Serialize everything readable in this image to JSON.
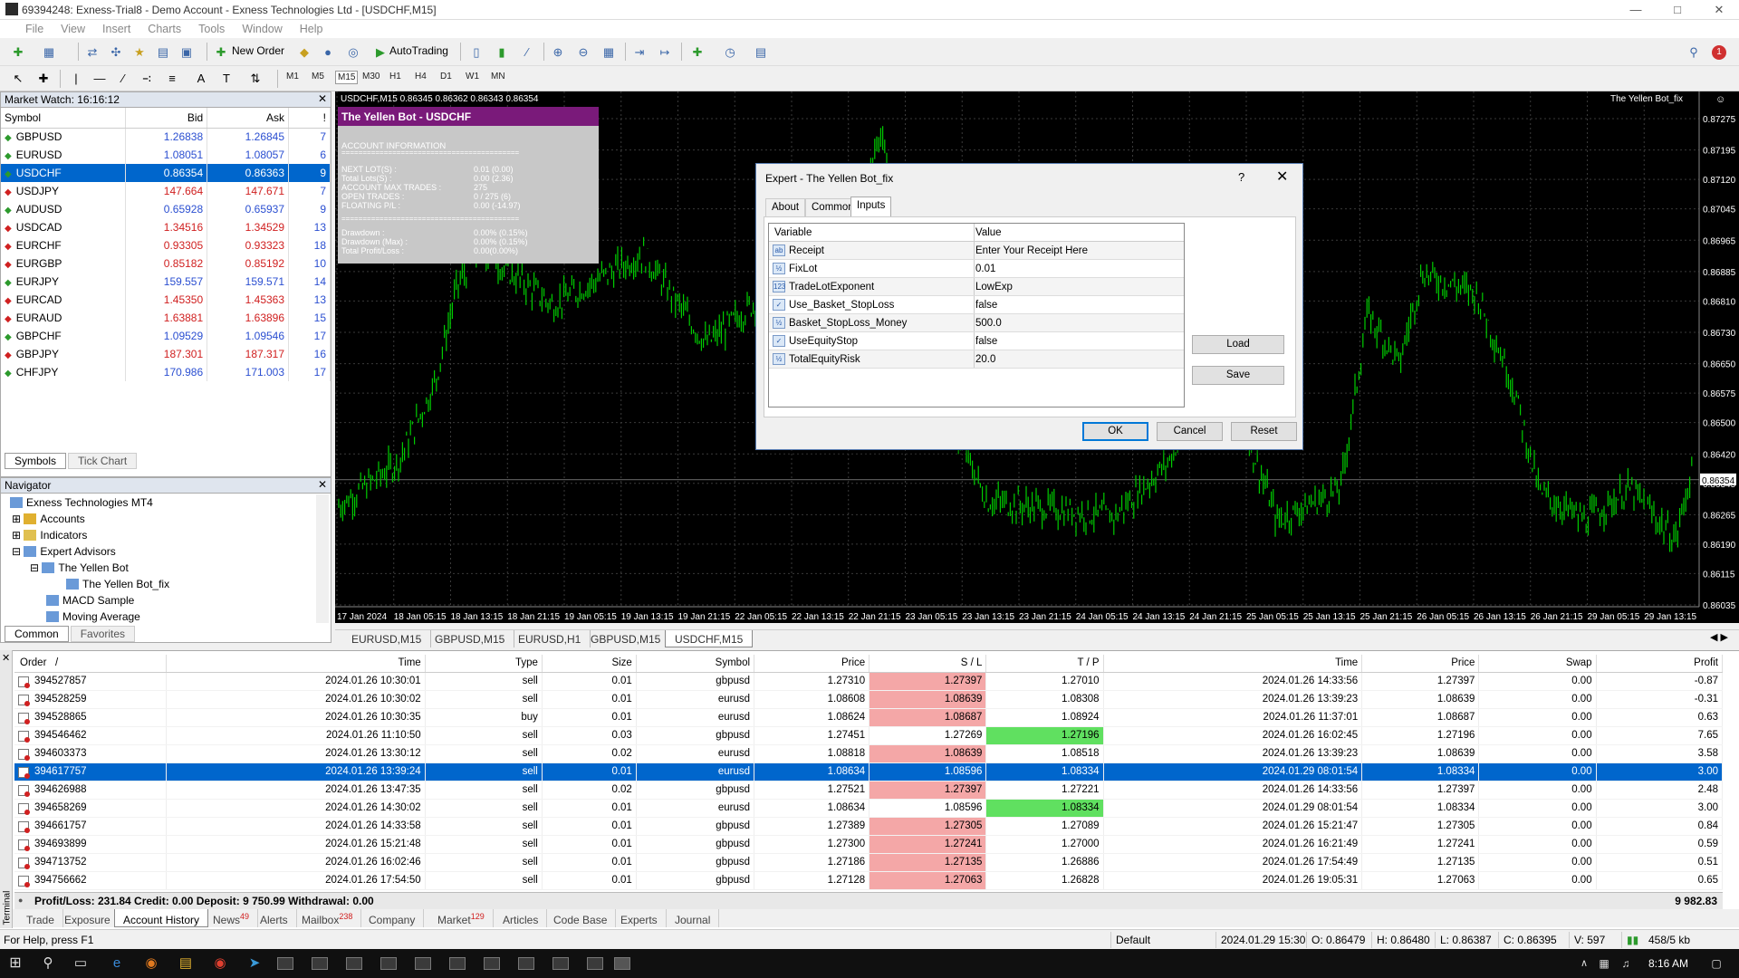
{
  "window": {
    "title": "69394248: Exness-Trial8 - Demo Account - Exness Technologies Ltd - [USDCHF,M15]"
  },
  "menu": [
    "File",
    "View",
    "Insert",
    "Charts",
    "Tools",
    "Window",
    "Help"
  ],
  "toolbar": {
    "new_order": "New Order",
    "autotrading": "AutoTrading",
    "timeframes": [
      "M1",
      "M5",
      "M15",
      "M30",
      "H1",
      "H4",
      "D1",
      "W1",
      "MN"
    ],
    "alert_count": "1"
  },
  "market_watch": {
    "title": "Market Watch: 16:16:12",
    "headers": {
      "symbol": "Symbol",
      "bid": "Bid",
      "ask": "Ask",
      "spread": "!"
    },
    "rows": [
      {
        "symbol": "GBPUSD",
        "bid": "1.26838",
        "ask": "1.26845",
        "spread": "7",
        "dir": "up"
      },
      {
        "symbol": "EURUSD",
        "bid": "1.08051",
        "ask": "1.08057",
        "spread": "6",
        "dir": "up"
      },
      {
        "symbol": "USDCHF",
        "bid": "0.86354",
        "ask": "0.86363",
        "spread": "9",
        "dir": "up"
      },
      {
        "symbol": "USDJPY",
        "bid": "147.664",
        "ask": "147.671",
        "spread": "7",
        "dir": "down"
      },
      {
        "symbol": "AUDUSD",
        "bid": "0.65928",
        "ask": "0.65937",
        "spread": "9",
        "dir": "up"
      },
      {
        "symbol": "USDCAD",
        "bid": "1.34516",
        "ask": "1.34529",
        "spread": "13",
        "dir": "down"
      },
      {
        "symbol": "EURCHF",
        "bid": "0.93305",
        "ask": "0.93323",
        "spread": "18",
        "dir": "down"
      },
      {
        "symbol": "EURGBP",
        "bid": "0.85182",
        "ask": "0.85192",
        "spread": "10",
        "dir": "down"
      },
      {
        "symbol": "EURJPY",
        "bid": "159.557",
        "ask": "159.571",
        "spread": "14",
        "dir": "up"
      },
      {
        "symbol": "EURCAD",
        "bid": "1.45350",
        "ask": "1.45363",
        "spread": "13",
        "dir": "down"
      },
      {
        "symbol": "EURAUD",
        "bid": "1.63881",
        "ask": "1.63896",
        "spread": "15",
        "dir": "down"
      },
      {
        "symbol": "GBPCHF",
        "bid": "1.09529",
        "ask": "1.09546",
        "spread": "17",
        "dir": "up"
      },
      {
        "symbol": "GBPJPY",
        "bid": "187.301",
        "ask": "187.317",
        "spread": "16",
        "dir": "down"
      },
      {
        "symbol": "CHFJPY",
        "bid": "170.986",
        "ask": "171.003",
        "spread": "17",
        "dir": "up"
      }
    ],
    "tabs": [
      "Symbols",
      "Tick Chart"
    ]
  },
  "navigator": {
    "title": "Navigator",
    "items": [
      "Exness Technologies MT4",
      "Accounts",
      "Indicators",
      "Expert Advisors",
      "The Yellen Bot",
      "The Yellen Bot_fix",
      "MACD Sample",
      "Moving Average"
    ],
    "tabs": [
      "Common",
      "Favorites"
    ]
  },
  "chart": {
    "info": "USDCHF,M15  0.86345 0.86362 0.86343 0.86354",
    "ea_label": "The Yellen Bot_fix",
    "current_price": "0.86354",
    "price_axis": [
      "0.87275",
      "0.87195",
      "0.87120",
      "0.87045",
      "0.86965",
      "0.86885",
      "0.86810",
      "0.86730",
      "0.86650",
      "0.86575",
      "0.86500",
      "0.86420",
      "0.86345",
      "0.86265",
      "0.86190",
      "0.86115",
      "0.86035"
    ],
    "time_axis": [
      "17 Jan 2024",
      "18 Jan 05:15",
      "18 Jan 13:15",
      "18 Jan 21:15",
      "19 Jan 05:15",
      "19 Jan 13:15",
      "19 Jan 21:15",
      "22 Jan 05:15",
      "22 Jan 13:15",
      "22 Jan 21:15",
      "23 Jan 05:15",
      "23 Jan 13:15",
      "23 Jan 21:15",
      "24 Jan 05:15",
      "24 Jan 13:15",
      "24 Jan 21:15",
      "25 Jan 05:15",
      "25 Jan 13:15",
      "25 Jan 21:15",
      "26 Jan 05:15",
      "26 Jan 13:15",
      "26 Jan 21:15",
      "29 Jan 05:15",
      "29 Jan 13:15"
    ],
    "tabs": [
      "EURUSD,M15",
      "GBPUSD,M15",
      "EURUSD,H1",
      "GBPUSD,M15",
      "USDCHF,M15"
    ]
  },
  "panel": {
    "title": "The Yellen Bot - USDCHF",
    "section": "ACCOUNT INFORMATION",
    "rows": [
      {
        "k": "NEXT LOT(S) :",
        "v": "0.01 (0.00)"
      },
      {
        "k": "Total Lots(S) :",
        "v": "0.00 (2.36)"
      },
      {
        "k": "ACCOUNT MAX TRADES :",
        "v": "275"
      },
      {
        "k": "OPEN TRADES :",
        "v": "0 / 275 (6)"
      },
      {
        "k": "FLOATING P/L :",
        "v": "0.00 (-14.97)"
      },
      {
        "k": "Drawdown :",
        "v": "0.00% (0.15%)"
      },
      {
        "k": "Drawdown (Max) :",
        "v": "0.00% (0.15%)"
      },
      {
        "k": "Total Profit/Loss :",
        "v": "0.00(0.00%)"
      }
    ],
    "divider": "=========================================="
  },
  "dialog": {
    "title": "Expert - The Yellen Bot_fix",
    "help": "?",
    "tabs": [
      "About",
      "Common",
      "Inputs"
    ],
    "headers": {
      "variable": "Variable",
      "value": "Value"
    },
    "rows": [
      {
        "var": "Receipt",
        "val": "Enter Your Receipt Here",
        "icon": "ab"
      },
      {
        "var": "FixLot",
        "val": "0.01",
        "icon": "½"
      },
      {
        "var": "TradeLotExponent",
        "val": "LowExp",
        "icon": "123"
      },
      {
        "var": "Use_Basket_StopLoss",
        "val": "false",
        "icon": "✓"
      },
      {
        "var": "Basket_StopLoss_Money",
        "val": "500.0",
        "icon": "½"
      },
      {
        "var": "UseEquityStop",
        "val": "false",
        "icon": "✓"
      },
      {
        "var": "TotalEquityRisk",
        "val": "20.0",
        "icon": "½"
      }
    ],
    "buttons": {
      "load": "Load",
      "save": "Save",
      "ok": "OK",
      "cancel": "Cancel",
      "reset": "Reset"
    }
  },
  "terminal": {
    "headers": {
      "order": "Order",
      "sort": "/",
      "time": "Time",
      "type": "Type",
      "size": "Size",
      "symbol": "Symbol",
      "price": "Price",
      "sl": "S / L",
      "tp": "T / P",
      "time2": "Time",
      "price2": "Price",
      "swap": "Swap",
      "profit": "Profit"
    },
    "rows": [
      {
        "order": "394527857",
        "time": "2024.01.26 10:30:01",
        "type": "sell",
        "size": "0.01",
        "symbol": "gbpusd",
        "price": "1.27310",
        "sl": "1.27397",
        "tp": "1.27010",
        "time2": "2024.01.26 14:33:56",
        "price2": "1.27397",
        "swap": "0.00",
        "profit": "-0.87",
        "slh": true,
        "tph": false
      },
      {
        "order": "394528259",
        "time": "2024.01.26 10:30:02",
        "type": "sell",
        "size": "0.01",
        "symbol": "eurusd",
        "price": "1.08608",
        "sl": "1.08639",
        "tp": "1.08308",
        "time2": "2024.01.26 13:39:23",
        "price2": "1.08639",
        "swap": "0.00",
        "profit": "-0.31",
        "slh": true,
        "tph": false
      },
      {
        "order": "394528865",
        "time": "2024.01.26 10:30:35",
        "type": "buy",
        "size": "0.01",
        "symbol": "eurusd",
        "price": "1.08624",
        "sl": "1.08687",
        "tp": "1.08924",
        "time2": "2024.01.26 11:37:01",
        "price2": "1.08687",
        "swap": "0.00",
        "profit": "0.63",
        "slh": true,
        "tph": false
      },
      {
        "order": "394546462",
        "time": "2024.01.26 11:10:50",
        "type": "sell",
        "size": "0.03",
        "symbol": "gbpusd",
        "price": "1.27451",
        "sl": "1.27269",
        "tp": "1.27196",
        "time2": "2024.01.26 16:02:45",
        "price2": "1.27196",
        "swap": "0.00",
        "profit": "7.65",
        "slh": false,
        "tph": true
      },
      {
        "order": "394603373",
        "time": "2024.01.26 13:30:12",
        "type": "sell",
        "size": "0.02",
        "symbol": "eurusd",
        "price": "1.08818",
        "sl": "1.08639",
        "tp": "1.08518",
        "time2": "2024.01.26 13:39:23",
        "price2": "1.08639",
        "swap": "0.00",
        "profit": "3.58",
        "slh": true,
        "tph": false
      },
      {
        "order": "394617757",
        "time": "2024.01.26 13:39:24",
        "type": "sell",
        "size": "0.01",
        "symbol": "eurusd",
        "price": "1.08634",
        "sl": "1.08596",
        "tp": "1.08334",
        "time2": "2024.01.29 08:01:54",
        "price2": "1.08334",
        "swap": "0.00",
        "profit": "3.00",
        "slh": false,
        "tph": true,
        "sel": true
      },
      {
        "order": "394626988",
        "time": "2024.01.26 13:47:35",
        "type": "sell",
        "size": "0.02",
        "symbol": "gbpusd",
        "price": "1.27521",
        "sl": "1.27397",
        "tp": "1.27221",
        "time2": "2024.01.26 14:33:56",
        "price2": "1.27397",
        "swap": "0.00",
        "profit": "2.48",
        "slh": true,
        "tph": false
      },
      {
        "order": "394658269",
        "time": "2024.01.26 14:30:02",
        "type": "sell",
        "size": "0.01",
        "symbol": "eurusd",
        "price": "1.08634",
        "sl": "1.08596",
        "tp": "1.08334",
        "time2": "2024.01.29 08:01:54",
        "price2": "1.08334",
        "swap": "0.00",
        "profit": "3.00",
        "slh": false,
        "tph": true
      },
      {
        "order": "394661757",
        "time": "2024.01.26 14:33:58",
        "type": "sell",
        "size": "0.01",
        "symbol": "gbpusd",
        "price": "1.27389",
        "sl": "1.27305",
        "tp": "1.27089",
        "time2": "2024.01.26 15:21:47",
        "price2": "1.27305",
        "swap": "0.00",
        "profit": "0.84",
        "slh": true,
        "tph": false
      },
      {
        "order": "394693899",
        "time": "2024.01.26 15:21:48",
        "type": "sell",
        "size": "0.01",
        "symbol": "gbpusd",
        "price": "1.27300",
        "sl": "1.27241",
        "tp": "1.27000",
        "time2": "2024.01.26 16:21:49",
        "price2": "1.27241",
        "swap": "0.00",
        "profit": "0.59",
        "slh": true,
        "tph": false
      },
      {
        "order": "394713752",
        "time": "2024.01.26 16:02:46",
        "type": "sell",
        "size": "0.01",
        "symbol": "gbpusd",
        "price": "1.27186",
        "sl": "1.27135",
        "tp": "1.26886",
        "time2": "2024.01.26 17:54:49",
        "price2": "1.27135",
        "swap": "0.00",
        "profit": "0.51",
        "slh": true,
        "tph": false
      },
      {
        "order": "394756662",
        "time": "2024.01.26 17:54:50",
        "type": "sell",
        "size": "0.01",
        "symbol": "gbpusd",
        "price": "1.27128",
        "sl": "1.27063",
        "tp": "1.26828",
        "time2": "2024.01.26 19:05:31",
        "price2": "1.27063",
        "swap": "0.00",
        "profit": "0.65",
        "slh": true,
        "tph": false
      }
    ],
    "summary": "Profit/Loss: 231.84  Credit: 0.00  Deposit: 9 750.99  Withdrawal: 0.00",
    "total": "9 982.83",
    "side_label": "Terminal",
    "tabs": [
      {
        "label": "Trade",
        "badge": ""
      },
      {
        "label": "Exposure",
        "badge": ""
      },
      {
        "label": "Account History",
        "badge": ""
      },
      {
        "label": "News",
        "badge": "49"
      },
      {
        "label": "Alerts",
        "badge": ""
      },
      {
        "label": "Mailbox",
        "badge": "238"
      },
      {
        "label": "Company",
        "badge": ""
      },
      {
        "label": "Market",
        "badge": "129"
      },
      {
        "label": "Articles",
        "badge": ""
      },
      {
        "label": "Code Base",
        "badge": ""
      },
      {
        "label": "Experts",
        "badge": ""
      },
      {
        "label": "Journal",
        "badge": ""
      }
    ]
  },
  "status": {
    "help": "For Help, press F1",
    "profile": "Default",
    "datetime": "2024.01.29 15:30",
    "o": "O: 0.86479",
    "h": "H: 0.86480",
    "l": "L: 0.86387",
    "c": "C: 0.86395",
    "v": "V: 597",
    "traffic": "458/5 kb"
  },
  "taskbar": {
    "time": "8:16 AM"
  }
}
